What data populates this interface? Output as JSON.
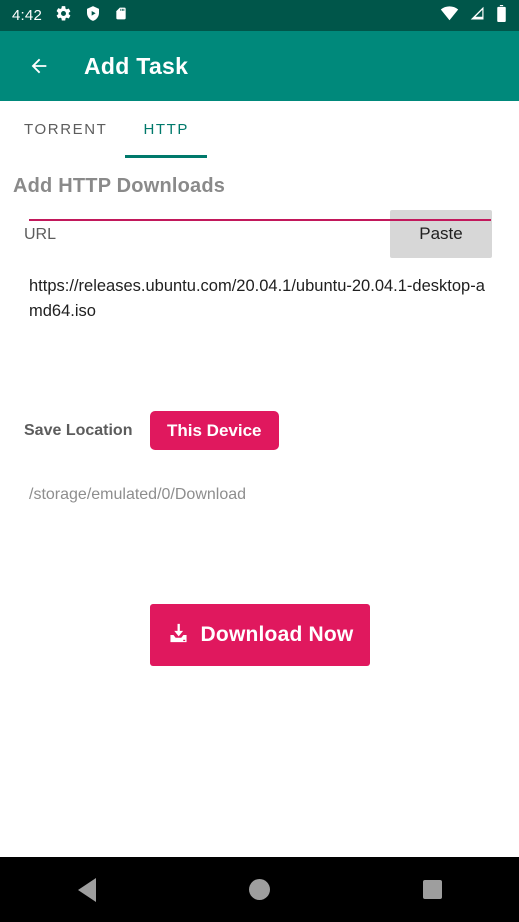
{
  "status_bar": {
    "time": "4:42",
    "icons": [
      "gear-icon",
      "shield-play-icon",
      "sd-card-icon"
    ],
    "right_icons": [
      "wifi-icon",
      "cellular-signal-icon",
      "battery-icon"
    ],
    "background": "#00564A"
  },
  "app_bar": {
    "back_label": "back-arrow",
    "title": "Add Task",
    "background": "#00897B"
  },
  "tabs": {
    "items": [
      {
        "label": "TORRENT",
        "active": false
      },
      {
        "label": "HTTP",
        "active": true
      }
    ],
    "active_color": "#00796B",
    "inactive_color": "#5d5d5d"
  },
  "main": {
    "section_title": "Add HTTP Downloads",
    "url": {
      "label": "URL",
      "value": "https://releases.ubuntu.com/20.04.1/ubuntu-20.04.1-desktop-amd64.iso",
      "placeholder": "",
      "underline_color": "#C2185B"
    },
    "paste_button": {
      "label": "Paste",
      "background": "#D7D7D7"
    },
    "save_location": {
      "label": "Save Location",
      "selected": "This Device",
      "path": "/storage/emulated/0/Download",
      "button_color": "#E0185E"
    },
    "download_button": {
      "label": "Download Now",
      "icon": "download-icon",
      "background": "#E0185E"
    }
  },
  "nav_bar": {
    "items": [
      "back-triangle",
      "home-circle",
      "recents-square"
    ],
    "background": "#000000",
    "icon_color": "#9E9E9E"
  }
}
